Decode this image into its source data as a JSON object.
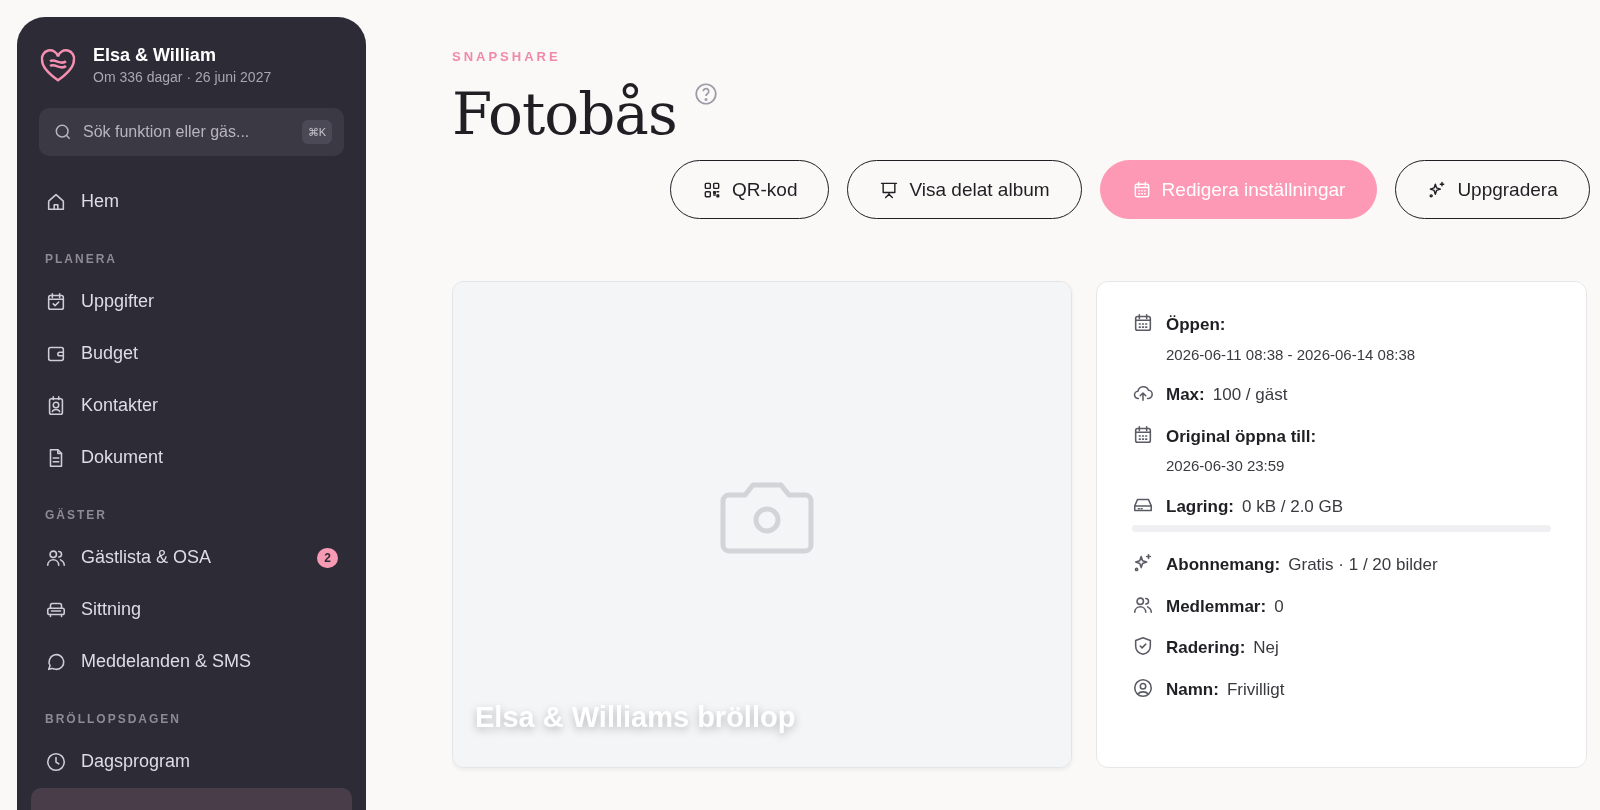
{
  "sidebar": {
    "couple": "Elsa & William",
    "countdown": "Om 336 dagar · 26 juni 2027",
    "search": {
      "placeholder": "Sök funktion eller gäs...",
      "shortcut": "⌘K"
    },
    "sections": [
      {
        "items": [
          {
            "label": "Hem",
            "selected": false
          }
        ]
      },
      {
        "heading": "PLANERA",
        "items": [
          {
            "label": "Uppgifter",
            "selected": false
          },
          {
            "label": "Budget",
            "selected": false
          },
          {
            "label": "Kontakter",
            "selected": false
          },
          {
            "label": "Dokument",
            "selected": false
          }
        ]
      },
      {
        "heading": "GÄSTER",
        "items": [
          {
            "label": "Gästlista & OSA",
            "selected": false,
            "badge": "2"
          },
          {
            "label": "Sittning",
            "selected": false
          },
          {
            "label": "Meddelanden & SMS",
            "selected": false
          }
        ]
      },
      {
        "heading": "BRÖLLOPSDAGEN",
        "items": [
          {
            "label": "Dagsprogram",
            "selected": false
          },
          {
            "selected": true
          }
        ]
      }
    ]
  },
  "page": {
    "eyebrow": "SNAPSHARE",
    "title": "Fotobås",
    "buttons": [
      {
        "label": "QR-kod",
        "kind": "outline"
      },
      {
        "label": "Visa delat album",
        "kind": "outline"
      },
      {
        "label": "Redigera inställningar",
        "kind": "primary"
      },
      {
        "label": "Uppgradera",
        "kind": "outline"
      }
    ],
    "album": {
      "kind": "picture",
      "caption": "Elsa & Williams bröllop"
    },
    "info": [
      {
        "kind": "stacked",
        "label": "Öppen:",
        "value": "2026-06-11 08:38 - 2026-06-14 08:38"
      },
      {
        "kind": "inline",
        "label": "Max:",
        "value": "100 / gäst"
      },
      {
        "kind": "stacked",
        "label": "Original öppna till:",
        "value": "2026-06-30 23:59"
      },
      {
        "kind": "meter",
        "label": "Lagring:",
        "value": "0 kB / 2.0 GB",
        "level": 0
      },
      {
        "kind": "inline",
        "label": "Abonnemang:",
        "value": "Gratis · 1 / 20 bilder"
      },
      {
        "kind": "inline",
        "label": "Medlemmar:",
        "value": "0"
      },
      {
        "kind": "inline",
        "label": "Radering:",
        "value": "Nej"
      },
      {
        "kind": "inline",
        "label": "Namn:",
        "value": "Frivilligt"
      }
    ]
  }
}
